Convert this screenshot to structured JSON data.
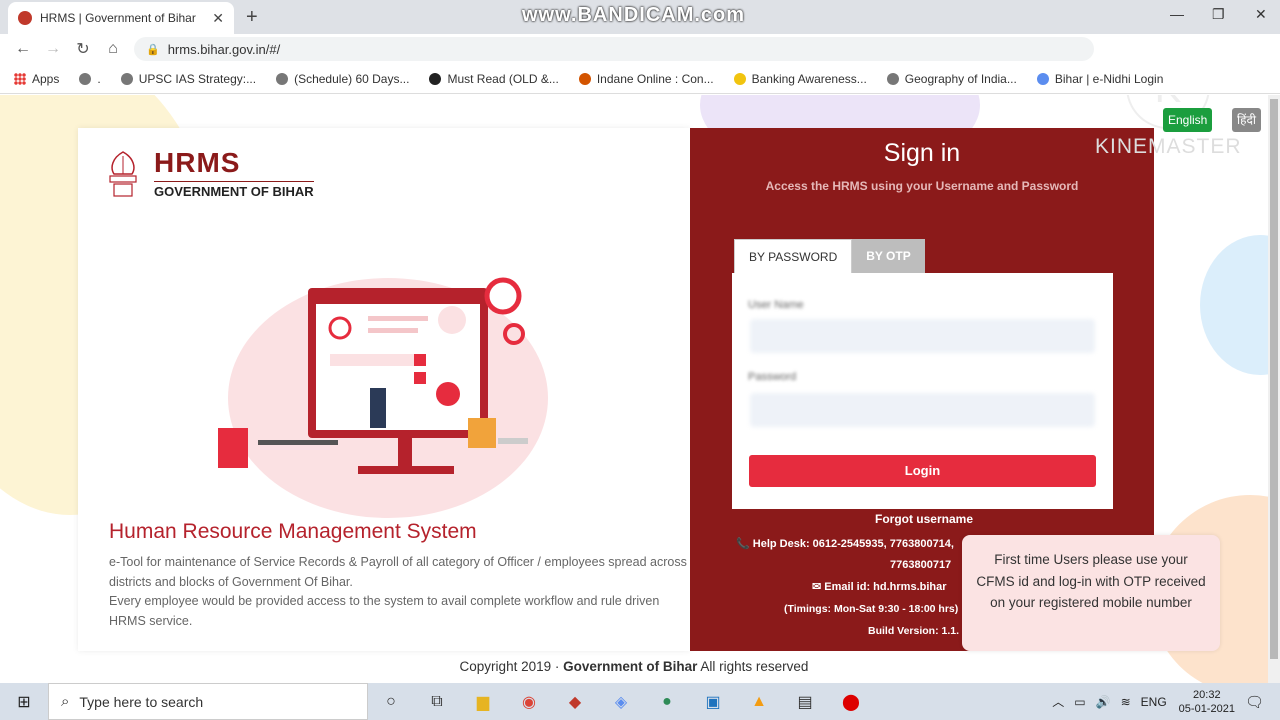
{
  "browser": {
    "tab_title": "HRMS | Government of Bihar",
    "tab_close": "✕",
    "new_tab": "+",
    "url": "hrms.bihar.gov.in/#/",
    "watermark": "www.BANDICAM.com",
    "window_controls": [
      "—",
      "❐",
      "✕"
    ]
  },
  "bookmarks": [
    {
      "label": "Apps"
    },
    {
      "label": "."
    },
    {
      "label": "UPSC IAS Strategy:..."
    },
    {
      "label": "(Schedule) 60 Days..."
    },
    {
      "label": "Must Read (OLD &..."
    },
    {
      "label": "Indane Online : Con..."
    },
    {
      "label": "Banking Awareness..."
    },
    {
      "label": "Geography of India..."
    },
    {
      "label": "Bihar | e-Nidhi Login"
    }
  ],
  "logo": {
    "title": "HRMS",
    "subtitle": "GOVERNMENT OF BIHAR"
  },
  "intro": {
    "title": "Human Resource Management System",
    "line1": "e-Tool for maintenance of Service Records & Payroll of all category of Officer / employees spread across districts and blocks of Government Of Bihar.",
    "line2": "Every employee would be provided access to the system to avail complete workflow and rule driven HRMS service."
  },
  "signin": {
    "title": "Sign in",
    "subtitle": "Access the HRMS using your Username and Password",
    "tab_password": "BY PASSWORD",
    "tab_otp": "BY OTP",
    "username_label": "User Name",
    "password_label": "Password",
    "login_label": "Login",
    "forgot": "Forgot username",
    "helpdesk": "Help Desk:   0612-2545935, 7763800714,",
    "helpdesk2": "7763800717",
    "email": "Email id:    hd.hrms.bihar",
    "timings": "(Timings: Mon-Sat 9:30 - 18:00 hrs)",
    "build": "Build Version: 1.1."
  },
  "lang": {
    "en": "English",
    "hi": "हिंदी"
  },
  "kinemaster": "KINEMASTER",
  "toast": "First time Users please use your CFMS id and log-in with OTP received on your registered mobile number",
  "footer": {
    "copy": "Copyright 2019 · ",
    "org": "Government of Bihar",
    "rights": " All rights reserved"
  },
  "taskbar": {
    "search_placeholder": "Type here to search",
    "lang": "ENG",
    "time": "20:32",
    "date": "05-01-2021"
  }
}
